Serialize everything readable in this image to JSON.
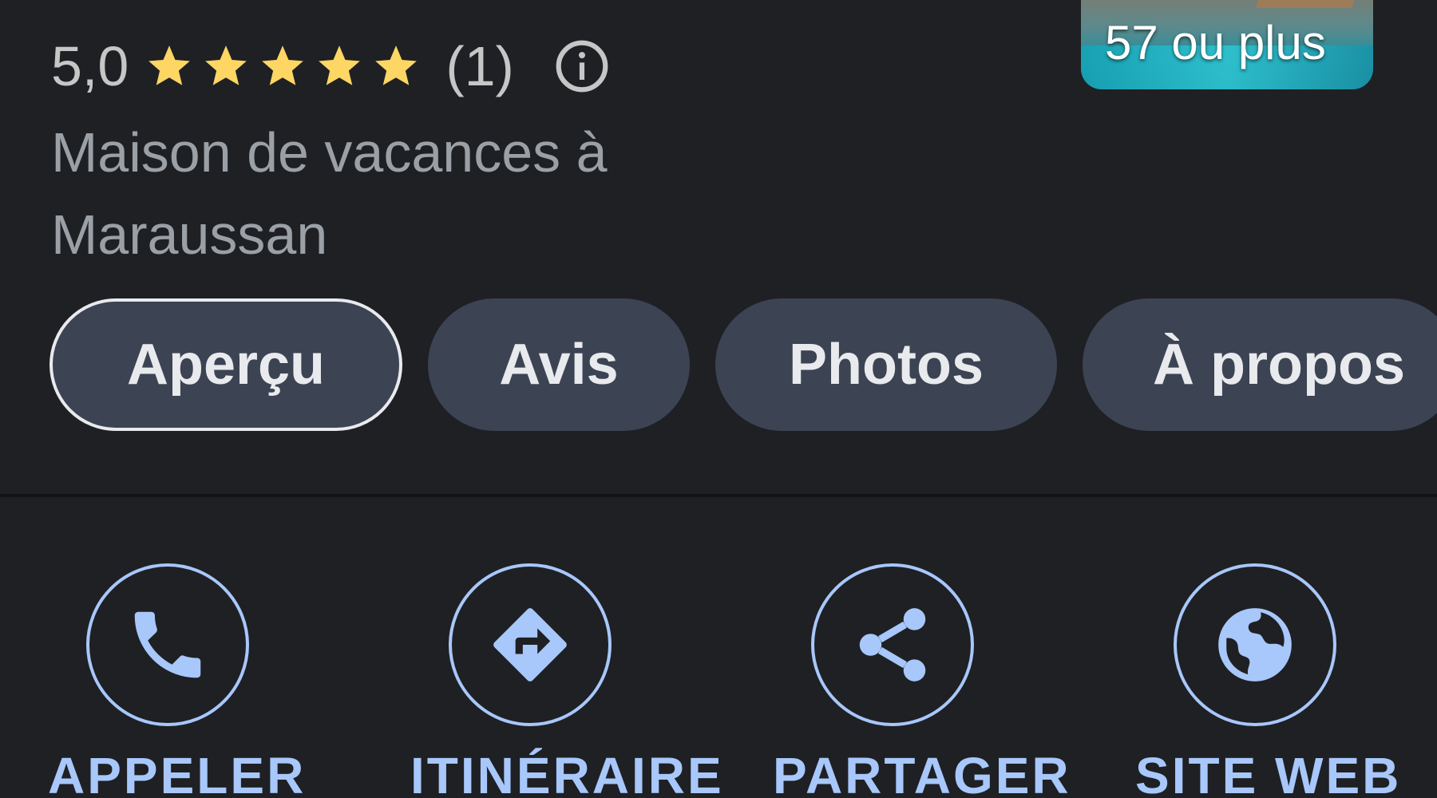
{
  "place": {
    "title_partial": "· · · · · g ·",
    "rating_value": "5,0",
    "stars_count": 5,
    "review_count": "(1)",
    "category": "Maison de vacances à Maraussan"
  },
  "photo": {
    "count_label": "57 ou plus"
  },
  "tabs": [
    {
      "label": "Aperçu",
      "active": true
    },
    {
      "label": "Avis",
      "active": false
    },
    {
      "label": "Photos",
      "active": false
    },
    {
      "label": "À propos",
      "active": false
    }
  ],
  "actions": [
    {
      "label": "APPELER",
      "icon": "phone-icon"
    },
    {
      "label": "ITINÉRAIRE",
      "icon": "directions-icon"
    },
    {
      "label": "PARTAGER",
      "icon": "share-icon"
    },
    {
      "label": "SITE WEB",
      "icon": "globe-icon"
    }
  ],
  "colors": {
    "background": "#1f2024",
    "star": "#fdd663",
    "accent": "#a8c7fa",
    "tab_bg": "#3c4353"
  }
}
